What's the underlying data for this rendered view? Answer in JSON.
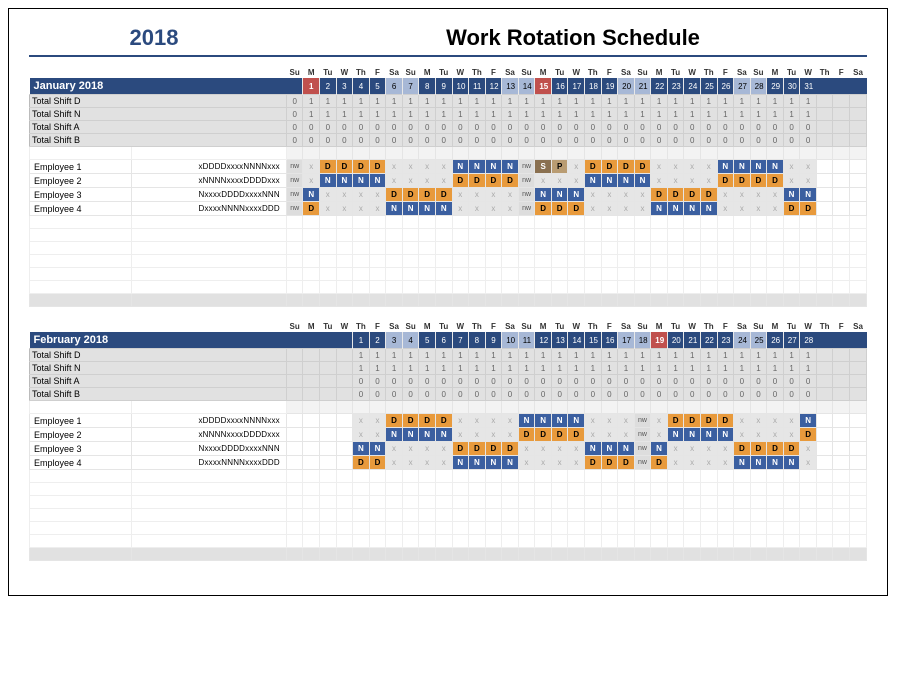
{
  "header": {
    "year": "2018",
    "title": "Work Rotation Schedule"
  },
  "dow_labels": [
    "Su",
    "M",
    "Tu",
    "W",
    "Th",
    "F",
    "Sa"
  ],
  "employees": [
    {
      "name": "Employee 1",
      "pattern": "xDDDDxxxxNNNNxxx"
    },
    {
      "name": "Employee 2",
      "pattern": "xNNNNxxxxDDDDxxx"
    },
    {
      "name": "Employee 3",
      "pattern": "NxxxxDDDDxxxxNNN"
    },
    {
      "name": "Employee 4",
      "pattern": "DxxxxNNNNxxxxDDD"
    }
  ],
  "totals_labels": [
    "Total Shift D",
    "Total Shift N",
    "Total Shift A",
    "Total Shift B"
  ],
  "months": [
    {
      "name": "January 2018",
      "lead_blank": 1,
      "days": 31,
      "holidays": [
        1,
        15
      ],
      "totals": {
        "D": [
          0,
          1,
          1,
          1,
          1,
          1,
          1,
          1,
          1,
          1,
          1,
          1,
          1,
          1,
          1,
          1,
          1,
          1,
          1,
          1,
          1,
          1,
          1,
          1,
          1,
          1,
          1,
          1,
          1,
          1,
          1,
          1
        ],
        "N": [
          0,
          1,
          1,
          1,
          1,
          1,
          1,
          1,
          1,
          1,
          1,
          1,
          1,
          1,
          1,
          1,
          1,
          1,
          1,
          1,
          1,
          1,
          1,
          1,
          1,
          1,
          1,
          1,
          1,
          1,
          1,
          1
        ],
        "A": [
          0,
          0,
          0,
          0,
          0,
          0,
          0,
          0,
          0,
          0,
          0,
          0,
          0,
          0,
          0,
          0,
          0,
          0,
          0,
          0,
          0,
          0,
          0,
          0,
          0,
          0,
          0,
          0,
          0,
          0,
          0,
          0
        ],
        "B": [
          0,
          0,
          0,
          0,
          0,
          0,
          0,
          0,
          0,
          0,
          0,
          0,
          0,
          0,
          0,
          0,
          0,
          0,
          0,
          0,
          0,
          0,
          0,
          0,
          0,
          0,
          0,
          0,
          0,
          0,
          0,
          0
        ]
      },
      "shifts": [
        [
          "nw",
          "x",
          "D",
          "D",
          "D",
          "D",
          "x",
          "x",
          "x",
          "x",
          "N",
          "N",
          "N",
          "N",
          "nw",
          "S",
          "P",
          "x",
          "D",
          "D",
          "D",
          "D",
          "x",
          "x",
          "x",
          "x",
          "N",
          "N",
          "N",
          "N",
          "x",
          "x"
        ],
        [
          "nw",
          "x",
          "N",
          "N",
          "N",
          "N",
          "x",
          "x",
          "x",
          "x",
          "D",
          "D",
          "D",
          "D",
          "nw",
          "x",
          "x",
          "x",
          "N",
          "N",
          "N",
          "N",
          "x",
          "x",
          "x",
          "x",
          "D",
          "D",
          "D",
          "D",
          "x",
          "x"
        ],
        [
          "nw",
          "N",
          "x",
          "x",
          "x",
          "x",
          "D",
          "D",
          "D",
          "D",
          "x",
          "x",
          "x",
          "x",
          "nw",
          "N",
          "N",
          "N",
          "x",
          "x",
          "x",
          "x",
          "D",
          "D",
          "D",
          "D",
          "x",
          "x",
          "x",
          "x",
          "N",
          "N"
        ],
        [
          "nw",
          "D",
          "x",
          "x",
          "x",
          "x",
          "N",
          "N",
          "N",
          "N",
          "x",
          "x",
          "x",
          "x",
          "nw",
          "D",
          "D",
          "D",
          "x",
          "x",
          "x",
          "x",
          "N",
          "N",
          "N",
          "N",
          "x",
          "x",
          "x",
          "x",
          "D",
          "D"
        ]
      ]
    },
    {
      "name": "February 2018",
      "lead_blank": 4,
      "days": 28,
      "holidays": [
        19
      ],
      "totals": {
        "D": [
          1,
          1,
          1,
          1,
          1,
          1,
          1,
          1,
          1,
          1,
          1,
          1,
          1,
          1,
          1,
          1,
          1,
          1,
          1,
          1,
          1,
          1,
          1,
          1,
          1,
          1,
          1,
          1
        ],
        "N": [
          1,
          1,
          1,
          1,
          1,
          1,
          1,
          1,
          1,
          1,
          1,
          1,
          1,
          1,
          1,
          1,
          1,
          1,
          1,
          1,
          1,
          1,
          1,
          1,
          1,
          1,
          1,
          1
        ],
        "A": [
          0,
          0,
          0,
          0,
          0,
          0,
          0,
          0,
          0,
          0,
          0,
          0,
          0,
          0,
          0,
          0,
          0,
          0,
          0,
          0,
          0,
          0,
          0,
          0,
          0,
          0,
          0,
          0
        ],
        "B": [
          0,
          0,
          0,
          0,
          0,
          0,
          0,
          0,
          0,
          0,
          0,
          0,
          0,
          0,
          0,
          0,
          0,
          0,
          0,
          0,
          0,
          0,
          0,
          0,
          0,
          0,
          0,
          0
        ]
      },
      "shifts": [
        [
          "x",
          "x",
          "D",
          "D",
          "D",
          "D",
          "x",
          "x",
          "x",
          "x",
          "N",
          "N",
          "N",
          "N",
          "x",
          "x",
          "x",
          "nw",
          "x",
          "D",
          "D",
          "D",
          "D",
          "x",
          "x",
          "x",
          "x",
          "N"
        ],
        [
          "x",
          "x",
          "N",
          "N",
          "N",
          "N",
          "x",
          "x",
          "x",
          "x",
          "D",
          "D",
          "D",
          "D",
          "x",
          "x",
          "x",
          "nw",
          "x",
          "N",
          "N",
          "N",
          "N",
          "x",
          "x",
          "x",
          "x",
          "D"
        ],
        [
          "N",
          "N",
          "x",
          "x",
          "x",
          "x",
          "D",
          "D",
          "D",
          "D",
          "x",
          "x",
          "x",
          "x",
          "N",
          "N",
          "N",
          "nw",
          "N",
          "x",
          "x",
          "x",
          "x",
          "D",
          "D",
          "D",
          "D",
          "x"
        ],
        [
          "D",
          "D",
          "x",
          "x",
          "x",
          "x",
          "N",
          "N",
          "N",
          "N",
          "x",
          "x",
          "x",
          "x",
          "D",
          "D",
          "D",
          "nw",
          "D",
          "x",
          "x",
          "x",
          "x",
          "N",
          "N",
          "N",
          "N",
          "x"
        ]
      ]
    }
  ]
}
